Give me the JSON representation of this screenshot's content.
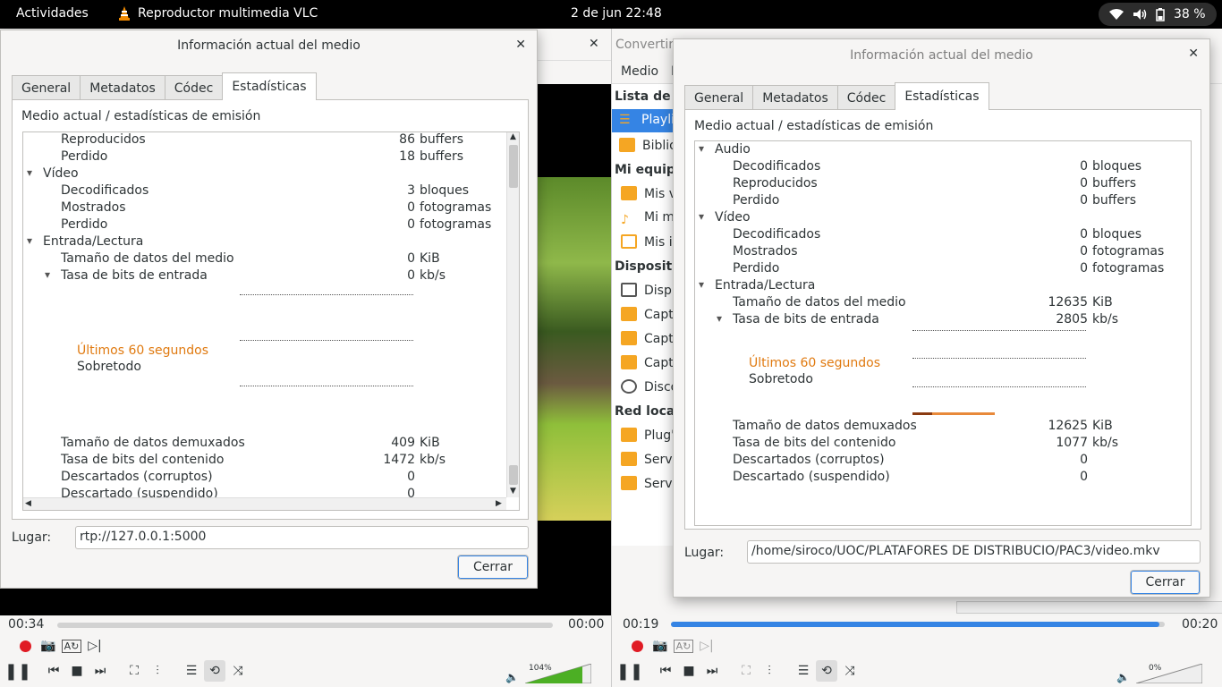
{
  "topbar": {
    "activities": "Actividades",
    "app_name": "Reproductor multimedia VLC",
    "clock": "2 de jun  22:48",
    "battery": "38 %"
  },
  "left_vlc": {
    "time_elapsed": "00:34",
    "time_total": "00:00",
    "volume": "104%"
  },
  "right_vlc": {
    "window_title": "Convertir",
    "menu": [
      "Medio",
      "R"
    ],
    "sidebar_header_playlist": "Lista de re",
    "sidebar_items_1": [
      "Playli",
      "Biblio"
    ],
    "sidebar_header_mycomputer": "Mi equipo",
    "sidebar_items_2": [
      "Mis v",
      "Mi m",
      "Mis i"
    ],
    "sidebar_header_devices": "Dispositiv",
    "sidebar_items_3": [
      "Disp",
      "Capt",
      "Capt",
      "Capt",
      "Disco"
    ],
    "sidebar_header_lan": "Red local",
    "sidebar_items_4": [
      "Plug'",
      "Servi",
      "Servi"
    ],
    "time_elapsed": "00:19",
    "time_total": "00:20",
    "progress": 0.99,
    "volume": "0%"
  },
  "dialog_left": {
    "title": "Información actual del medio",
    "tabs": [
      "General",
      "Metadatos",
      "Códec",
      "Estadísticas"
    ],
    "section_title": "Medio actual / estadísticas de emisión",
    "rows": [
      {
        "label": "Reproducidos",
        "value": "86",
        "unit": "buffers"
      },
      {
        "label": "Perdido",
        "value": "18",
        "unit": "buffers"
      },
      {
        "label": "Vídeo",
        "value": "",
        "unit": ""
      },
      {
        "label": "Decodificados",
        "value": "3",
        "unit": "bloques"
      },
      {
        "label": "Mostrados",
        "value": "0",
        "unit": "fotogramas"
      },
      {
        "label": "Perdido",
        "value": "0",
        "unit": "fotogramas"
      },
      {
        "label": "Entrada/Lectura",
        "value": "",
        "unit": ""
      },
      {
        "label": "Tamaño de datos del medio",
        "value": "0",
        "unit": "KiB"
      },
      {
        "label": "Tasa de bits de entrada",
        "value": "0",
        "unit": "kb/s"
      }
    ],
    "graph_legend_1": "Últimos 60 segundos",
    "graph_legend_2": "Sobretodo",
    "rows_after": [
      {
        "label": "Tamaño de datos demuxados",
        "value": "409",
        "unit": "KiB"
      },
      {
        "label": "Tasa de bits del contenido",
        "value": "1472",
        "unit": "kb/s"
      },
      {
        "label": "Descartados (corruptos)",
        "value": "0",
        "unit": ""
      },
      {
        "label": "Descartado (suspendido)",
        "value": "0",
        "unit": ""
      }
    ],
    "location_label": "Lugar:",
    "location_value": "rtp://127.0.0.1:5000",
    "close": "Cerrar"
  },
  "dialog_right": {
    "title": "Información actual del medio",
    "tabs": [
      "General",
      "Metadatos",
      "Códec",
      "Estadísticas"
    ],
    "section_title": "Medio actual / estadísticas de emisión",
    "rows": [
      {
        "label": "Audio",
        "value": "",
        "unit": ""
      },
      {
        "label": "Decodificados",
        "value": "0",
        "unit": "bloques"
      },
      {
        "label": "Reproducidos",
        "value": "0",
        "unit": "buffers"
      },
      {
        "label": "Perdido",
        "value": "0",
        "unit": "buffers"
      },
      {
        "label": "Vídeo",
        "value": "",
        "unit": ""
      },
      {
        "label": "Decodificados",
        "value": "0",
        "unit": "bloques"
      },
      {
        "label": "Mostrados",
        "value": "0",
        "unit": "fotogramas"
      },
      {
        "label": "Perdido",
        "value": "0",
        "unit": "fotogramas"
      },
      {
        "label": "Entrada/Lectura",
        "value": "",
        "unit": ""
      },
      {
        "label": "Tamaño de datos del medio",
        "value": "12635",
        "unit": "KiB"
      },
      {
        "label": "Tasa de bits de entrada",
        "value": "2805",
        "unit": "kb/s"
      }
    ],
    "graph_legend_1": "Últimos 60 segundos",
    "graph_legend_2": "Sobretodo",
    "rows_after": [
      {
        "label": "Tamaño de datos demuxados",
        "value": "12625",
        "unit": "KiB"
      },
      {
        "label": "Tasa de bits del contenido",
        "value": "1077",
        "unit": "kb/s"
      },
      {
        "label": "Descartados (corruptos)",
        "value": "0",
        "unit": ""
      },
      {
        "label": "Descartado (suspendido)",
        "value": "0",
        "unit": ""
      }
    ],
    "location_label": "Lugar:",
    "location_value": "/home/siroco/UOC/PLATAFORES DE DISTRIBUCIO/PAC3/video.mkv",
    "close": "Cerrar"
  }
}
